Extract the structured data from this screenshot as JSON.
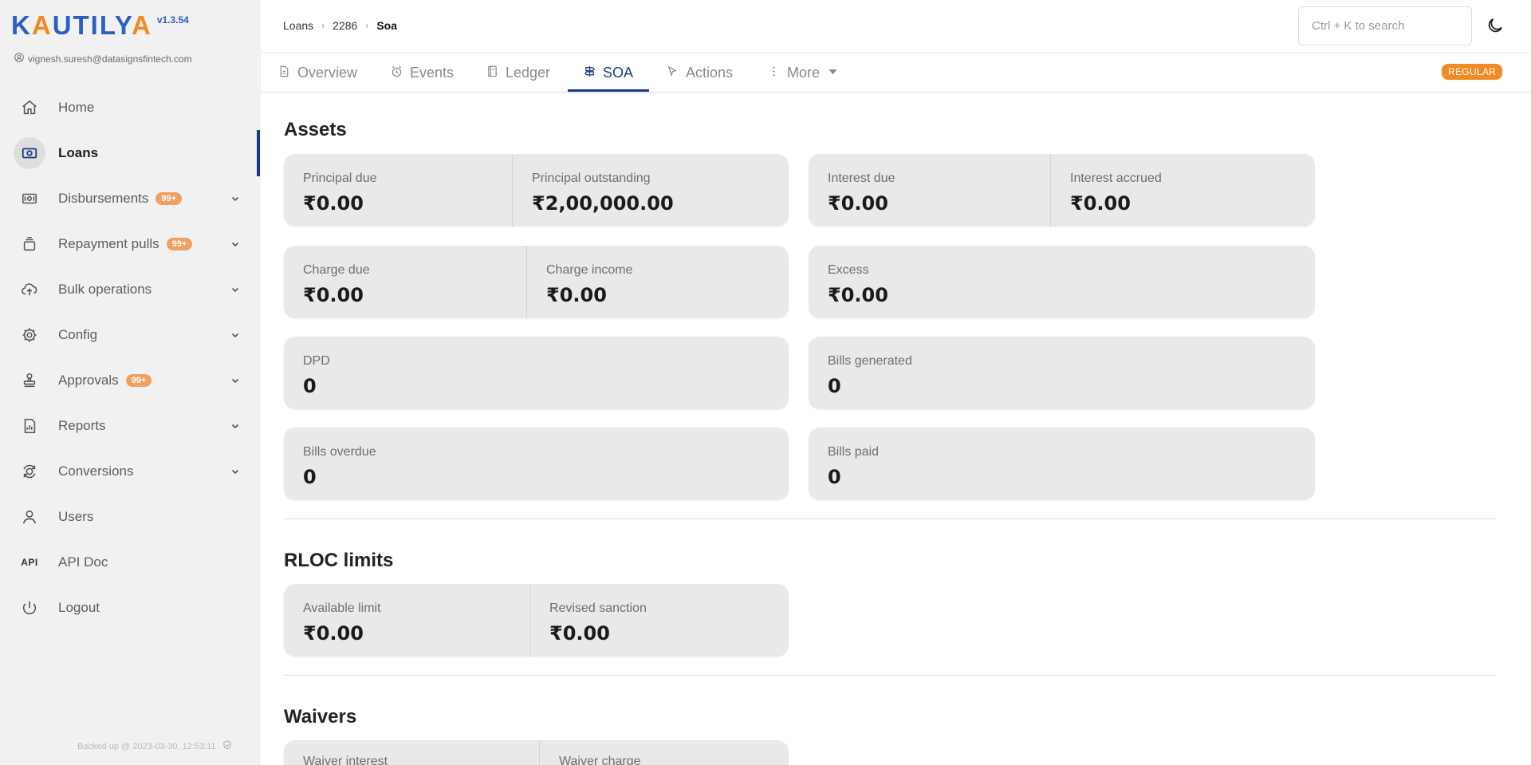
{
  "app": {
    "logo_prefix": "K",
    "logo_a1": "A",
    "logo_mid": "UTIL",
    "logo_y": "Y",
    "logo_a2": "A",
    "version": "v1.3.54",
    "user_email": "vignesh.suresh@datasignsfintech.com",
    "brand_color": "#2b5fc4",
    "accent_color": "#f08a24"
  },
  "sidebar": {
    "items": [
      {
        "label": "Home",
        "icon": "home-icon"
      },
      {
        "label": "Loans",
        "icon": "loans-icon",
        "active": true
      },
      {
        "label": "Disbursements",
        "icon": "disbursement-icon",
        "badge": "99+"
      },
      {
        "label": "Repayment pulls",
        "icon": "repayment-icon",
        "badge": "99+"
      },
      {
        "label": "Bulk operations",
        "icon": "cloud-upload-icon"
      },
      {
        "label": "Config",
        "icon": "gear-icon"
      },
      {
        "label": "Approvals",
        "icon": "stamp-icon",
        "badge": "99+"
      },
      {
        "label": "Reports",
        "icon": "report-icon"
      },
      {
        "label": "Conversions",
        "icon": "conversion-icon"
      },
      {
        "label": "Users",
        "icon": "user-icon"
      },
      {
        "label": "API Doc",
        "icon": "api-icon",
        "icon_text": "API"
      },
      {
        "label": "Logout",
        "icon": "power-icon"
      }
    ],
    "backup_text": "Backed up @ 2023-03-30, 12:53:11"
  },
  "header": {
    "breadcrumb": [
      "Loans",
      "2286",
      "Soa"
    ],
    "search_placeholder": "Ctrl + K to search"
  },
  "tabs": [
    {
      "label": "Overview",
      "icon": "document-icon"
    },
    {
      "label": "Events",
      "icon": "alarm-icon"
    },
    {
      "label": "Ledger",
      "icon": "ledger-icon"
    },
    {
      "label": "SOA",
      "icon": "signpost-icon",
      "active": true
    },
    {
      "label": "Actions",
      "icon": "cursor-icon"
    },
    {
      "label": "More",
      "icon": "kebab-icon"
    }
  ],
  "status_badge": "REGULAR",
  "sections": {
    "assets": {
      "title": "Assets",
      "principal_due": {
        "label": "Principal due",
        "value": "₹0.00"
      },
      "principal_outstanding": {
        "label": "Principal outstanding",
        "value": "₹2,00,000.00"
      },
      "interest_due": {
        "label": "Interest due",
        "value": "₹0.00"
      },
      "interest_accrued": {
        "label": "Interest accrued",
        "value": "₹0.00"
      },
      "charge_due": {
        "label": "Charge due",
        "value": "₹0.00"
      },
      "charge_income": {
        "label": "Charge income",
        "value": "₹0.00"
      },
      "excess": {
        "label": "Excess",
        "value": "₹0.00"
      },
      "dpd": {
        "label": "DPD",
        "value": "0"
      },
      "bills_generated": {
        "label": "Bills generated",
        "value": "0"
      },
      "bills_overdue": {
        "label": "Bills overdue",
        "value": "0"
      },
      "bills_paid": {
        "label": "Bills paid",
        "value": "0"
      }
    },
    "rloc": {
      "title": "RLOC limits",
      "available_limit": {
        "label": "Available limit",
        "value": "₹0.00"
      },
      "revised_sanction": {
        "label": "Revised sanction",
        "value": "₹0.00"
      }
    },
    "waivers": {
      "title": "Waivers",
      "waiver_interest": {
        "label": "Waiver interest"
      },
      "waiver_charge": {
        "label": "Waiver charge"
      }
    }
  }
}
